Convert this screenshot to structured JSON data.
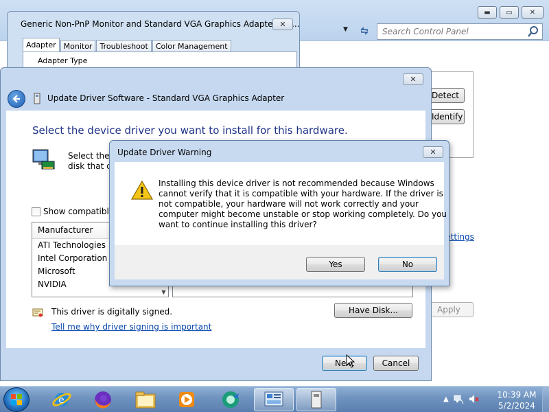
{
  "control_panel": {
    "search_placeholder": "Search Control Panel",
    "detect_button": "Detect",
    "identify_button": "Identify",
    "advanced_settings_link": "settings",
    "apply_button": "Apply"
  },
  "properties_window": {
    "title": "Generic Non-PnP Monitor and Standard VGA Graphics Adapter Pro...",
    "tabs": [
      "Adapter",
      "Monitor",
      "Troubleshoot",
      "Color Management"
    ],
    "section_label": "Adapter Type"
  },
  "wizard": {
    "title": "Update Driver Software - Standard VGA Graphics Adapter",
    "heading": "Select the device driver you want to install for this hardware.",
    "description_line1": "Select the n",
    "description_line2": "disk that co",
    "show_compatible_label": "Show compatible h",
    "manufacturer_header": "Manufacturer",
    "manufacturers": [
      "ATI Technologies Inc.",
      "Intel Corporation",
      "Microsoft",
      "NVIDIA"
    ],
    "signed_text": "This driver is digitally signed.",
    "signing_link": "Tell me why driver signing is important",
    "have_disk_button": "Have Disk...",
    "next_button": "Next",
    "cancel_button": "Cancel"
  },
  "warning_dialog": {
    "title": "Update Driver Warning",
    "message_lines": [
      "Installing this device driver is not recommended because Windows",
      "cannot verify that it is compatible with your hardware.  If the driver is",
      "not compatible, your hardware will not work correctly and your",
      "computer might become unstable or stop working completely.  Do you",
      "want to continue installing this driver?"
    ],
    "yes_button": "Yes",
    "no_button": "No"
  },
  "taskbar": {
    "apps": [
      "internet-explorer",
      "firefox",
      "file-explorer",
      "media-player",
      "wmc-app",
      "control-panel",
      "device-window"
    ],
    "clock_time": "10:39 AM",
    "clock_date": "5/2/2024"
  },
  "colors": {
    "heading_blue": "#1e3287",
    "link_blue": "#0645ad",
    "title_bar": "#c8daf0",
    "taskbar": "#6f93bf"
  }
}
